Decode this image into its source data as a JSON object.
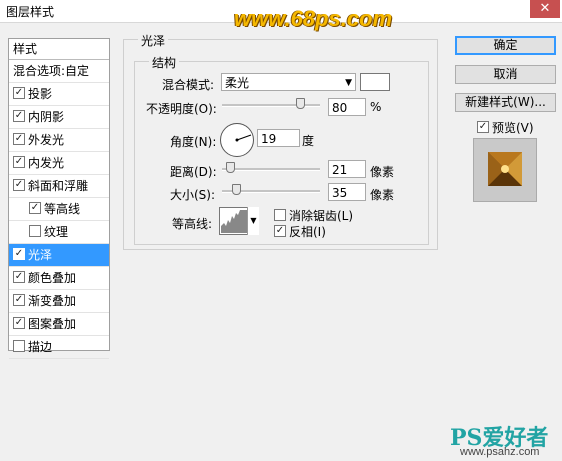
{
  "window": {
    "title": "图层样式",
    "close_glyph": "✕"
  },
  "watermark": "www.68ps.com",
  "style_list": {
    "header": "样式",
    "items": [
      {
        "label": "混合选项:自定",
        "checkbox": false,
        "checked": false,
        "indent": false,
        "selected": false
      },
      {
        "label": "投影",
        "checkbox": true,
        "checked": true,
        "indent": false,
        "selected": false
      },
      {
        "label": "内阴影",
        "checkbox": true,
        "checked": true,
        "indent": false,
        "selected": false
      },
      {
        "label": "外发光",
        "checkbox": true,
        "checked": true,
        "indent": false,
        "selected": false
      },
      {
        "label": "内发光",
        "checkbox": true,
        "checked": true,
        "indent": false,
        "selected": false
      },
      {
        "label": "斜面和浮雕",
        "checkbox": true,
        "checked": true,
        "indent": false,
        "selected": false
      },
      {
        "label": "等高线",
        "checkbox": true,
        "checked": true,
        "indent": true,
        "selected": false
      },
      {
        "label": "纹理",
        "checkbox": true,
        "checked": false,
        "indent": true,
        "selected": false
      },
      {
        "label": "光泽",
        "checkbox": true,
        "checked": true,
        "indent": false,
        "selected": true
      },
      {
        "label": "颜色叠加",
        "checkbox": true,
        "checked": true,
        "indent": false,
        "selected": false
      },
      {
        "label": "渐变叠加",
        "checkbox": true,
        "checked": true,
        "indent": false,
        "selected": false
      },
      {
        "label": "图案叠加",
        "checkbox": true,
        "checked": true,
        "indent": false,
        "selected": false
      },
      {
        "label": "描边",
        "checkbox": true,
        "checked": false,
        "indent": false,
        "selected": false
      }
    ]
  },
  "satin": {
    "group_title": "光泽",
    "structure_title": "结构",
    "blend_mode": {
      "label": "混合模式:",
      "value": "柔光"
    },
    "opacity": {
      "label": "不透明度(O):",
      "value": "80",
      "unit": "%",
      "level": 0.8
    },
    "angle": {
      "label": "角度(N):",
      "value": "19",
      "unit": "度"
    },
    "distance": {
      "label": "距离(D):",
      "value": "21",
      "unit": "像素",
      "level": 0.08
    },
    "size": {
      "label": "大小(S):",
      "value": "35",
      "unit": "像素",
      "level": 0.14
    },
    "contour": {
      "label": "等高线:"
    },
    "anti_alias": {
      "label": "消除锯齿(L)",
      "checked": false
    },
    "invert": {
      "label": "反相(I)",
      "checked": true
    }
  },
  "buttons": {
    "ok": "确定",
    "cancel": "取消",
    "new_style": "新建样式(W)...",
    "preview_label": "预览(V)",
    "preview_checked": true
  },
  "site_logo": {
    "main": "PS爱好者",
    "sub": "www.psahz.com"
  }
}
